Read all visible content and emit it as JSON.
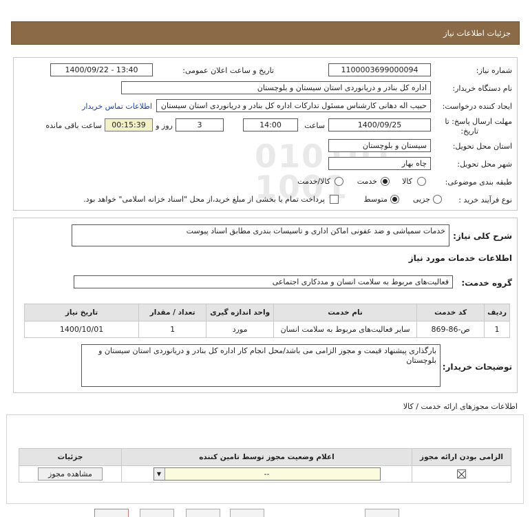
{
  "page": {
    "title": "جزئیات اطلاعات نیاز"
  },
  "form": {
    "need_number_label": "شماره نیاز:",
    "need_number": "1100003699000094",
    "announce_label": "تاریخ و ساعت اعلان عمومی:",
    "announce_value": "1400/09/22 - 13:40",
    "buyer_org_label": "نام دستگاه خریدار:",
    "buyer_org": "اداره کل بنادر و دریانوردی استان سیستان و بلوچستان",
    "creator_label": "ایجاد کننده درخواست:",
    "creator": "حبیب اله دهانی کارشناس مسئول تدارکات اداره کل بنادر و دریانوردی استان سیستان",
    "contact_link": "اطلاعات تماس خریدار",
    "deadline_label": "مهلت ارسال پاسخ: تا",
    "deadline_label2": "تاریخ:",
    "deadline_date": "1400/09/25",
    "time_label": "ساعت",
    "deadline_time": "14:00",
    "days_value": "3",
    "days_label": "روز و",
    "remaining_time": "00:15:39",
    "remaining_label": "ساعت باقی مانده",
    "province_label": "استان محل تحویل:",
    "province": "سیستان و بلوچستان",
    "city_label": "شهر محل تحویل:",
    "city": "چاه بهار",
    "category_label": "طبقه بندی موضوعی:",
    "category_options": [
      "کالا",
      "خدمت",
      "کالا/خدمت"
    ],
    "category_selected": "خدمت",
    "process_label": "نوع فرآیند خرید :",
    "process_options": [
      "جزیی",
      "متوسط"
    ],
    "process_selected": "متوسط",
    "payment_note": "پرداخت تمام یا بخشی از مبلغ خرید،از محل \"اسناد خزانه اسلامی\" خواهد بود."
  },
  "description": {
    "label": "شرح کلی نیاز:",
    "value": "خدمات سمپاشی و ضد عفونی اماکن اداری و تاسیسات بندری مطابق اسناد پیوست"
  },
  "services": {
    "section_title": "اطلاعات خدمات مورد نیاز",
    "group_label": "گروه خدمت:",
    "group_value": "فعالیت‌های مربوط به سلامت انسان و مددکاری اجتماعی",
    "table": {
      "headers": [
        "ردیف",
        "کد خدمت",
        "نام خدمت",
        "واحد اندازه گیری",
        "تعداد / مقدار",
        "تاریخ نیاز"
      ],
      "rows": [
        [
          "1",
          "ص-86-869",
          "سایر فعالیت‌های مربوط به سلامت انسان",
          "مورد",
          "1",
          "1400/10/01"
        ]
      ]
    },
    "buyer_notes_label": "توضیحات خریدار:",
    "buyer_notes": "بارگذاری پیشنهاد قیمت و مجوز الزامی می باشد/محل انجام کار اداره کل بنادر و دریانوردی استان سیستان و بلوچستان"
  },
  "permits": {
    "section_title": "اطلاعات مجوزهای ارائه خدمت / کالا",
    "headers": [
      "الزامی بودن ارائه مجوز",
      "اعلام وضعیت مجوز توسط تامین کننده",
      "جزئیات"
    ],
    "status_value": "--",
    "view_button": "مشاهده مجوز"
  },
  "colors": {
    "titlebar": "#8b6a48",
    "link": "#1a3fb5",
    "timer_bg": "#f2f0c6"
  }
}
